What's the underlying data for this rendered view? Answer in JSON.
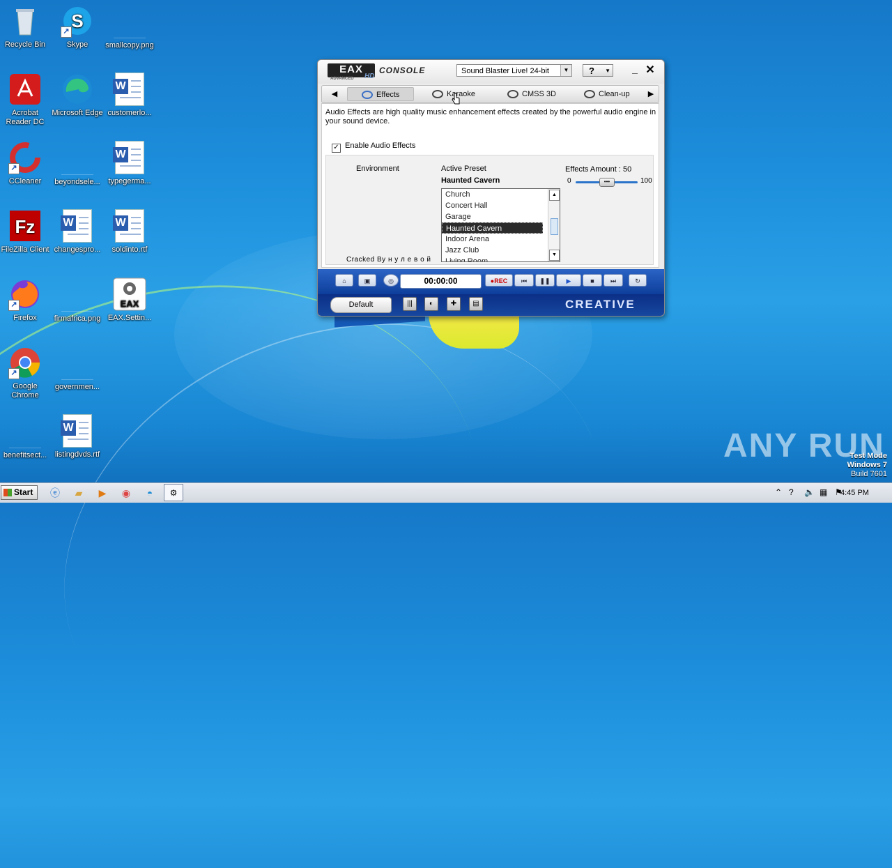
{
  "desktop": {
    "icons": [
      {
        "label": "Recycle Bin",
        "icon": "recycle-bin-icon"
      },
      {
        "label": "Skype",
        "icon": "skype-icon"
      },
      {
        "label": "smallcopy.png",
        "icon": "image-file-icon"
      },
      {
        "label": "Acrobat Reader DC",
        "icon": "acrobat-icon"
      },
      {
        "label": "Microsoft Edge",
        "icon": "edge-icon"
      },
      {
        "label": "customerlo...",
        "icon": "word-doc-icon"
      },
      {
        "label": "CCleaner",
        "icon": "ccleaner-icon"
      },
      {
        "label": "beyondsele...",
        "icon": "file-icon"
      },
      {
        "label": "typegerma...",
        "icon": "word-doc-icon"
      },
      {
        "label": "FileZilla Client",
        "icon": "filezilla-icon"
      },
      {
        "label": "changespro...",
        "icon": "word-doc-icon"
      },
      {
        "label": "soldinto.rtf",
        "icon": "word-doc-icon"
      },
      {
        "label": "Firefox",
        "icon": "firefox-icon"
      },
      {
        "label": "firmafrica.png",
        "icon": "image-file-icon"
      },
      {
        "label": "EAX.Settin...",
        "icon": "eax-settings-icon"
      },
      {
        "label": "Google Chrome",
        "icon": "chrome-icon"
      },
      {
        "label": "governmen...",
        "icon": "file-icon"
      },
      {
        "label": "benefitsect...",
        "icon": "file-icon"
      },
      {
        "label": "listingdvds.rtf",
        "icon": "word-doc-icon"
      }
    ]
  },
  "window": {
    "logo": "EAX",
    "logo_sub": "ADVANCED",
    "logo_hd": "HD",
    "title": "CONSOLE",
    "device": "Sound Blaster Live! 24-bit",
    "help": "?",
    "tabs": [
      {
        "label": "Effects"
      },
      {
        "label": "Karaoke"
      },
      {
        "label": "CMSS 3D"
      },
      {
        "label": "Clean-up"
      }
    ],
    "description": "Audio Effects are high quality music enhancement effects created by the powerful audio engine in your sound device.",
    "enable_label": "Enable Audio Effects",
    "enable_checked": true,
    "environment_label": "Environment",
    "active_preset_label": "Active Preset",
    "active_preset_value": "Haunted Cavern",
    "effects_amount_label": "Effects Amount : 50",
    "effects_amount_value": 50,
    "slider_min": "0",
    "slider_max": "100",
    "presets": [
      "Church",
      "Concert Hall",
      "Garage",
      "Haunted Cavern",
      "Indoor Arena",
      "Jazz Club",
      "Living Room"
    ],
    "selected_preset_index": 3,
    "cracked_text": "Cracked By н у л е в о й",
    "timer": "00:00:00",
    "rec_label": "●REC",
    "default_button": "Default",
    "brand": "CREATIVE"
  },
  "taskbar": {
    "start_label": "Start",
    "clock": "4:45 PM"
  },
  "watermark": {
    "anyrun": "ANY RUN",
    "testmode_line1": "Test Mode",
    "testmode_line2": "Windows 7",
    "testmode_line3": "Build 7601"
  }
}
